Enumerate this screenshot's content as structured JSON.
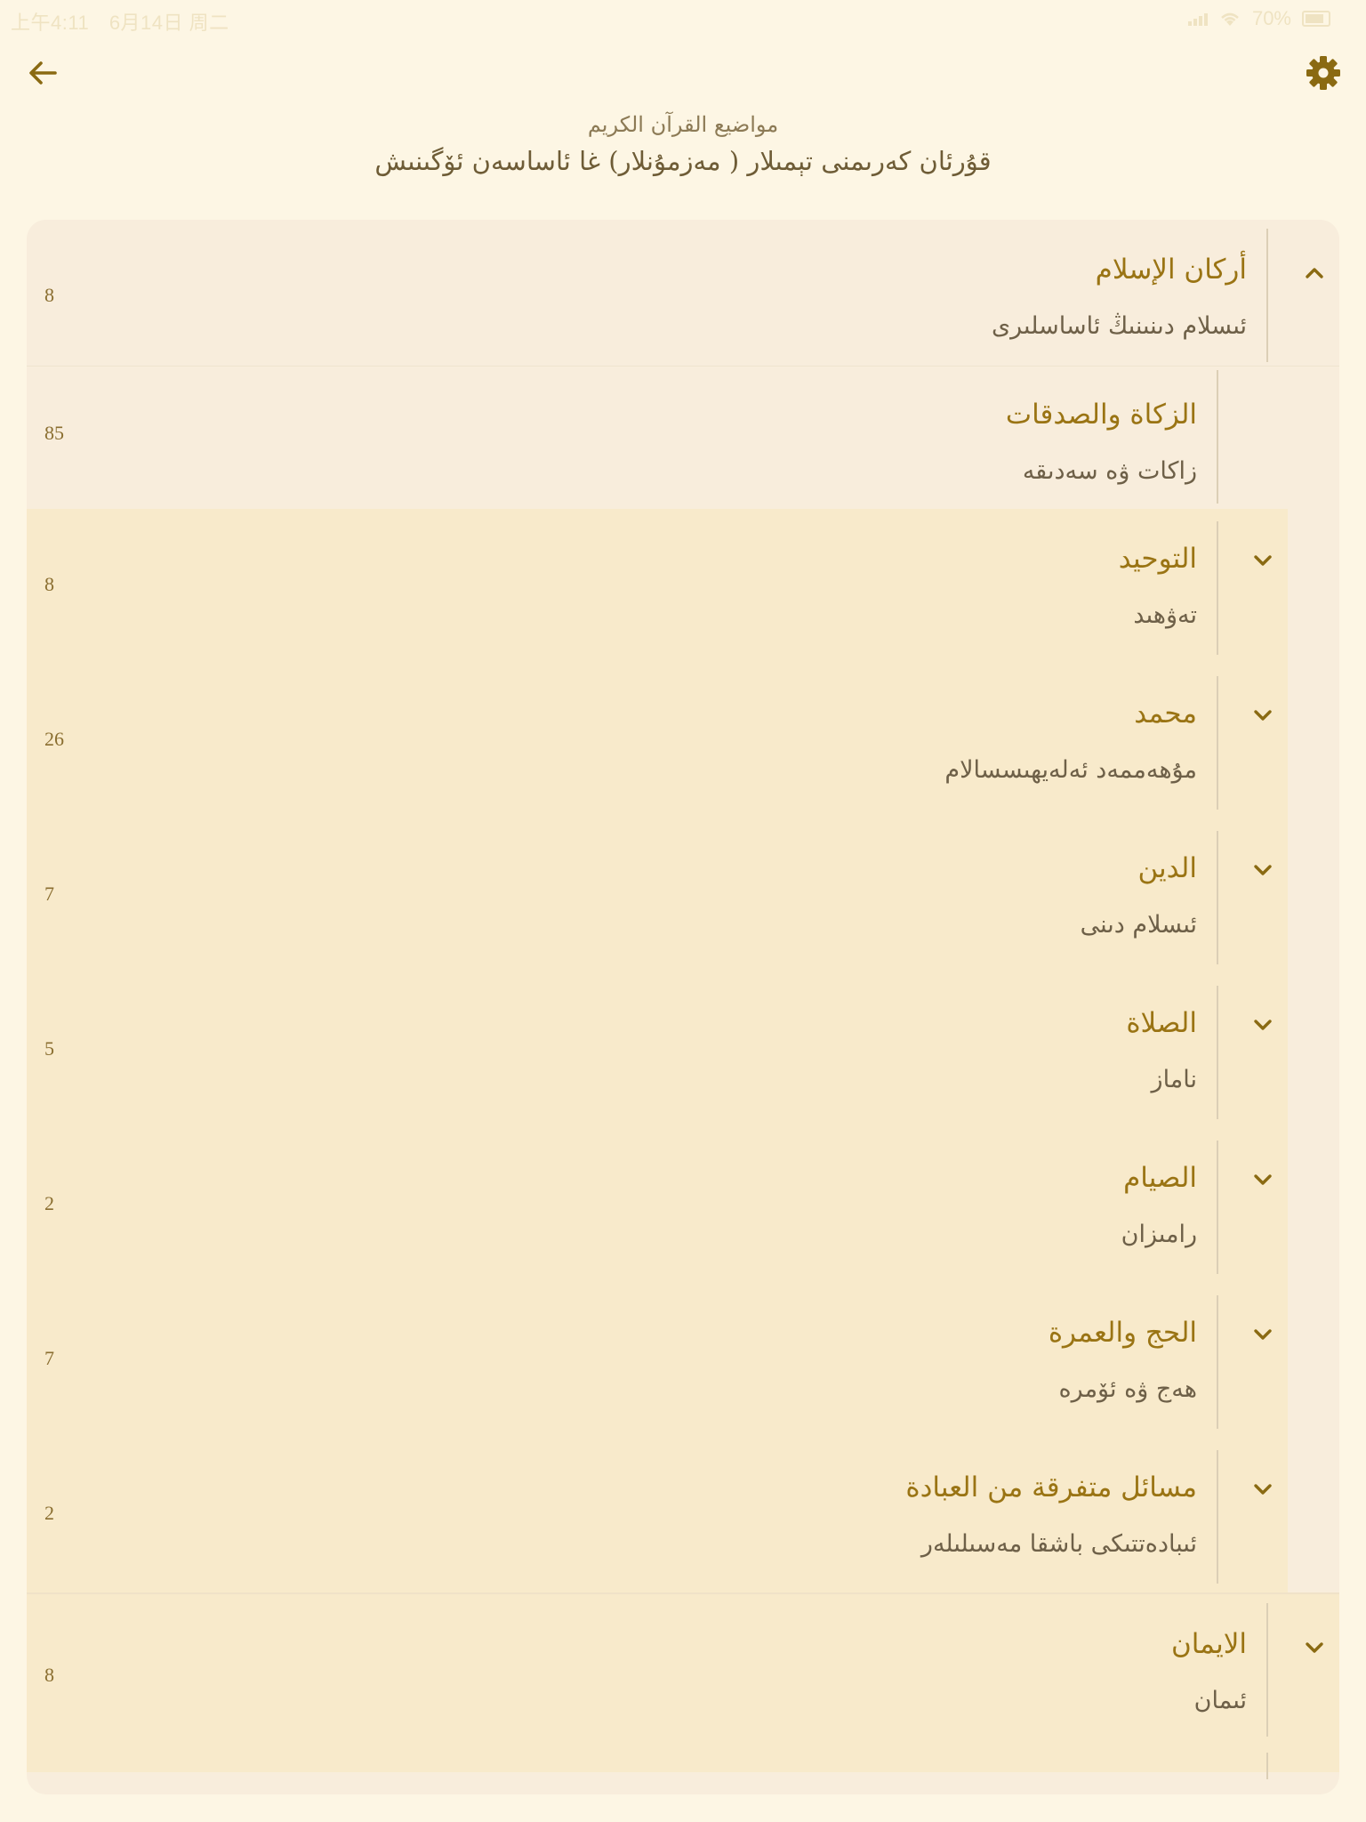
{
  "status_bar": {
    "time": "上午4:11",
    "date": "6月14日 周二",
    "battery": "70%"
  },
  "header": {
    "back_icon": "arrow-left-icon",
    "settings_icon": "gear-icon",
    "title_arabic": "مواضيع القرآن الكريم",
    "title_uyghur": "قۇرئان كەرىمنى تېمىلار ( مەزمۇنلار) غا ئاساسەن ئۆگىنىش"
  },
  "colors": {
    "accent": "#8a6a12",
    "background": "#fdf6e4",
    "card": "#f8eddc",
    "sub_rows": "#f8eacb"
  },
  "topics": {
    "main": {
      "arabic": "أركان الإسلام",
      "uyghur": "ئىسلام دىنىنىڭ ئاساسلىرى",
      "count": "8",
      "expanded": true
    },
    "zakat": {
      "arabic": "الزكاة والصدقات",
      "uyghur": "زاكات ۋە سەدىقە",
      "count": "85"
    },
    "subtopics": [
      {
        "arabic": "التوحيد",
        "uyghur": "تەۋھىد",
        "count": "8"
      },
      {
        "arabic": "محمد",
        "uyghur": "مۇھەممەد ئەلەيھىسسالام",
        "count": "26"
      },
      {
        "arabic": "الدين",
        "uyghur": "ئىسلام دىنى",
        "count": "7"
      },
      {
        "arabic": "الصلاة",
        "uyghur": "ناماز",
        "count": "5"
      },
      {
        "arabic": "الصيام",
        "uyghur": "رامىزان",
        "count": "2"
      },
      {
        "arabic": "الحج والعمرة",
        "uyghur": "ھەج ۋە ئۆمرە",
        "count": "7"
      },
      {
        "arabic": "مسائل متفرقة من العبادة",
        "uyghur": "ئىبادەتتىكى باشقا مەسىلىلەر",
        "count": "2"
      }
    ],
    "iman": {
      "arabic": "الايمان",
      "uyghur": "ئىمان",
      "count": "8"
    }
  }
}
